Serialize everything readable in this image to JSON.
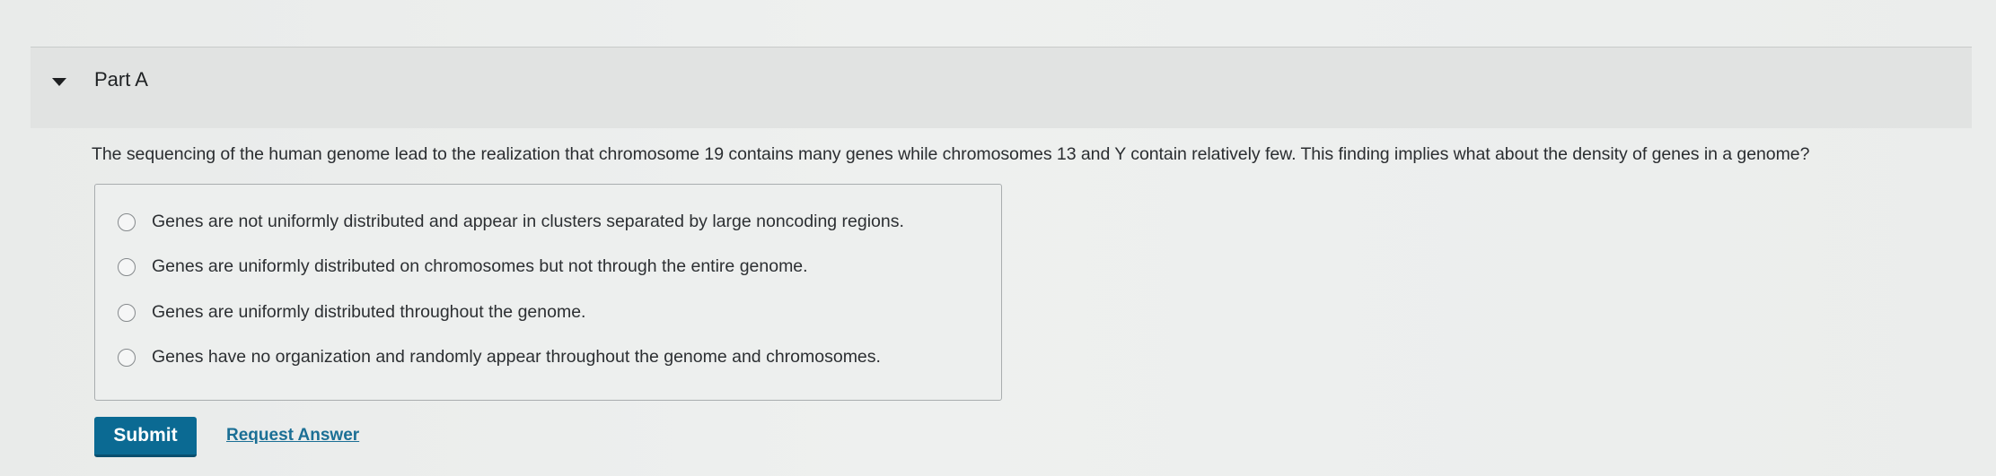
{
  "part": {
    "title": "Part A",
    "toggle_icon": "caret-down-icon"
  },
  "question": {
    "text": "The sequencing of the human genome lead to the realization that chromosome 19 contains many genes while chromosomes 13 and Y contain relatively few. This finding implies what about the density of genes in a genome?"
  },
  "options": [
    {
      "label": "Genes are not uniformly distributed and appear in clusters separated by large noncoding regions.",
      "selected": false
    },
    {
      "label": "Genes are uniformly distributed on chromosomes but not through the entire genome.",
      "selected": false
    },
    {
      "label": "Genes are uniformly distributed throughout the genome.",
      "selected": false
    },
    {
      "label": "Genes have no organization and randomly appear throughout the genome and chromosomes.",
      "selected": false
    }
  ],
  "actions": {
    "submit_label": "Submit",
    "request_answer_label": "Request Answer"
  },
  "colors": {
    "submit_bg": "#0b6a93",
    "link": "#1b6f95",
    "header_bg": "#e1e3e2"
  }
}
